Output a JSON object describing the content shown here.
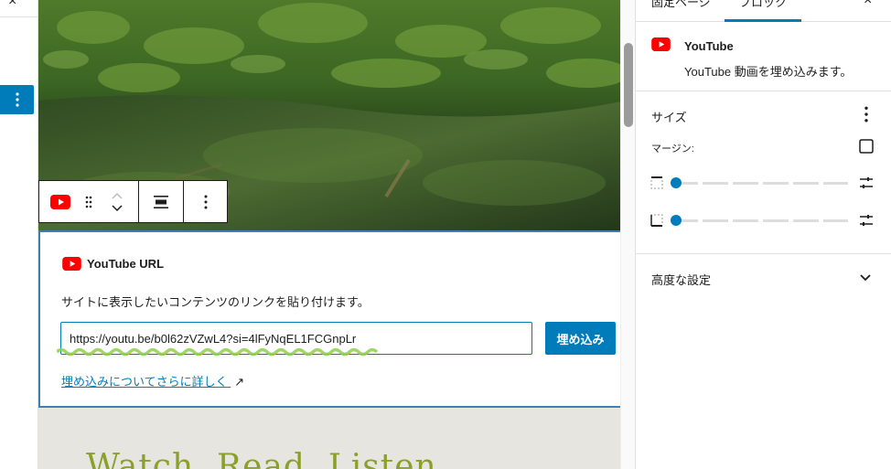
{
  "editor": {
    "close_glyph": "×"
  },
  "toolbar": {
    "block_icon": "youtube-icon",
    "drag_icon": "drag-handle-icon",
    "move_up_icon": "chevron-up-icon",
    "move_down_icon": "chevron-down-icon",
    "align_icon": "align-wide-icon",
    "options_icon": "more-vertical-icon"
  },
  "placeholder": {
    "title": "YouTube URL",
    "description": "サイトに表示したいコンテンツのリンクを貼り付けます。",
    "url_value": "https://youtu.be/b0l62zVZwL4?si=4lFyNqEL1FCGnpLr",
    "embed_label": "埋め込み",
    "learn_more": "埋め込みについてさらに詳しく",
    "learn_more_arrow": "↗"
  },
  "canvas": {
    "heading_partial": "Watch, Read, Listen"
  },
  "sidebar": {
    "tabs": [
      {
        "label": "固定ページ"
      },
      {
        "label": "ブロック",
        "active": true
      }
    ],
    "close_glyph": "×",
    "block": {
      "title": "YouTube",
      "description": "YouTube 動画を埋め込みます。"
    },
    "size_panel": {
      "title": "サイズ",
      "margin_label": "マージン:",
      "sliders": [
        {
          "side": "top",
          "value": 0
        },
        {
          "side": "bottom",
          "value": 0
        }
      ]
    },
    "advanced": {
      "title": "高度な設定"
    }
  },
  "colors": {
    "accent": "#007cba",
    "youtube_red": "#ff0000",
    "heading_green": "#8ba02b"
  }
}
